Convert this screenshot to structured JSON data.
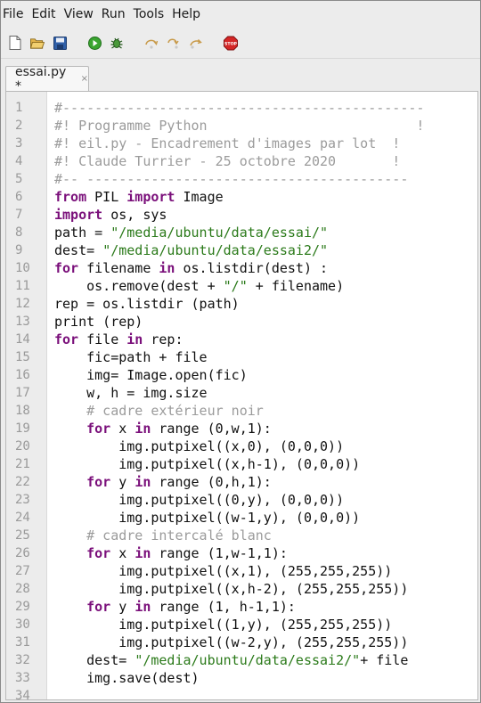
{
  "menu": [
    "File",
    "Edit",
    "View",
    "Run",
    "Tools",
    "Help"
  ],
  "toolbar": [
    {
      "name": "new-file-icon"
    },
    {
      "name": "open-folder-icon"
    },
    {
      "name": "save-icon"
    },
    {
      "name": "run-icon"
    },
    {
      "name": "debug-icon"
    },
    {
      "name": "step-over-icon"
    },
    {
      "name": "step-into-icon"
    },
    {
      "name": "step-out-icon"
    },
    {
      "name": "stop-icon",
      "label": "STOP"
    }
  ],
  "tab": {
    "title": "essai.py *",
    "close": "×"
  },
  "code_lines": [
    {
      "n": "1",
      "t": [
        [
          "cmt",
          "#---------------------------------------------"
        ]
      ]
    },
    {
      "n": "2",
      "t": [
        [
          "cmt",
          "#! Programme Python                          !"
        ]
      ]
    },
    {
      "n": "3",
      "t": [
        [
          "cmt",
          "#! eil.py - Encadrement d'images par lot  !"
        ]
      ]
    },
    {
      "n": "4",
      "t": [
        [
          "cmt",
          "#! Claude Turrier - 25 octobre 2020       !"
        ]
      ]
    },
    {
      "n": "5",
      "t": [
        [
          "cmt",
          "#-- ----------------------------------------"
        ]
      ]
    },
    {
      "n": "6",
      "t": [
        [
          "kw",
          "from"
        ],
        [
          "plain",
          " PIL "
        ],
        [
          "kw",
          "import"
        ],
        [
          "plain",
          " Image"
        ]
      ]
    },
    {
      "n": "7",
      "t": [
        [
          "kw",
          "import"
        ],
        [
          "plain",
          " os, sys"
        ]
      ]
    },
    {
      "n": "8",
      "t": [
        [
          "plain",
          "path = "
        ],
        [
          "str",
          "\"/media/ubuntu/data/essai/\""
        ]
      ]
    },
    {
      "n": "9",
      "t": [
        [
          "plain",
          "dest= "
        ],
        [
          "str",
          "\"/media/ubuntu/data/essai2/\""
        ]
      ]
    },
    {
      "n": "10",
      "t": [
        [
          "kw",
          "for"
        ],
        [
          "plain",
          " filename "
        ],
        [
          "kw",
          "in"
        ],
        [
          "plain",
          " os.listdir(dest) :"
        ]
      ]
    },
    {
      "n": "11",
      "t": [
        [
          "plain",
          "    os.remove(dest + "
        ],
        [
          "str",
          "\"/\""
        ],
        [
          "plain",
          " + filename)"
        ]
      ]
    },
    {
      "n": "12",
      "t": [
        [
          "plain",
          "rep = os.listdir (path)"
        ]
      ]
    },
    {
      "n": "13",
      "t": [
        [
          "plain",
          "print (rep)"
        ]
      ]
    },
    {
      "n": "14",
      "t": [
        [
          "kw",
          "for"
        ],
        [
          "plain",
          " file "
        ],
        [
          "kw",
          "in"
        ],
        [
          "plain",
          " rep:"
        ]
      ]
    },
    {
      "n": "15",
      "t": [
        [
          "plain",
          "    fic=path + file"
        ]
      ]
    },
    {
      "n": "16",
      "t": [
        [
          "plain",
          "    img= Image.open(fic)"
        ]
      ]
    },
    {
      "n": "17",
      "t": [
        [
          "plain",
          "    w, h = img.size"
        ]
      ]
    },
    {
      "n": "18",
      "t": [
        [
          "cmt",
          "    # cadre extérieur noir"
        ]
      ]
    },
    {
      "n": "19",
      "t": [
        [
          "plain",
          "    "
        ],
        [
          "kw",
          "for"
        ],
        [
          "plain",
          " x "
        ],
        [
          "kw",
          "in"
        ],
        [
          "plain",
          " range (0,w,1):"
        ]
      ]
    },
    {
      "n": "20",
      "t": [
        [
          "plain",
          "        img.putpixel((x,0), (0,0,0))"
        ]
      ]
    },
    {
      "n": "21",
      "t": [
        [
          "plain",
          "        img.putpixel((x,h-1), (0,0,0))"
        ]
      ]
    },
    {
      "n": "22",
      "t": [
        [
          "plain",
          "    "
        ],
        [
          "kw",
          "for"
        ],
        [
          "plain",
          " y "
        ],
        [
          "kw",
          "in"
        ],
        [
          "plain",
          " range (0,h,1):"
        ]
      ]
    },
    {
      "n": "23",
      "t": [
        [
          "plain",
          "        img.putpixel((0,y), (0,0,0))"
        ]
      ]
    },
    {
      "n": "24",
      "t": [
        [
          "plain",
          "        img.putpixel((w-1,y), (0,0,0))"
        ]
      ]
    },
    {
      "n": "25",
      "t": [
        [
          "cmt",
          "    # cadre intercalé blanc"
        ]
      ]
    },
    {
      "n": "26",
      "t": [
        [
          "plain",
          "    "
        ],
        [
          "kw",
          "for"
        ],
        [
          "plain",
          " x "
        ],
        [
          "kw",
          "in"
        ],
        [
          "plain",
          " range (1,w-1,1):"
        ]
      ]
    },
    {
      "n": "27",
      "t": [
        [
          "plain",
          "        img.putpixel((x,1), (255,255,255))"
        ]
      ]
    },
    {
      "n": "28",
      "t": [
        [
          "plain",
          "        img.putpixel((x,h-2), (255,255,255))"
        ]
      ]
    },
    {
      "n": "29",
      "t": [
        [
          "plain",
          "    "
        ],
        [
          "kw",
          "for"
        ],
        [
          "plain",
          " y "
        ],
        [
          "kw",
          "in"
        ],
        [
          "plain",
          " range (1, h-1,1):"
        ]
      ]
    },
    {
      "n": "30",
      "t": [
        [
          "plain",
          "        img.putpixel((1,y), (255,255,255))"
        ]
      ]
    },
    {
      "n": "31",
      "t": [
        [
          "plain",
          "        img.putpixel((w-2,y), (255,255,255))"
        ]
      ]
    },
    {
      "n": "32",
      "t": [
        [
          "plain",
          "    dest= "
        ],
        [
          "str",
          "\"/media/ubuntu/data/essai2/\""
        ],
        [
          "plain",
          "+ file"
        ]
      ]
    },
    {
      "n": "33",
      "t": [
        [
          "plain",
          "    img.save(dest)"
        ]
      ]
    },
    {
      "n": "34",
      "t": []
    }
  ],
  "colors": {
    "keyword": "#7a0f7a",
    "string": "#2b7a1a",
    "comment": "#9b9b9b"
  }
}
